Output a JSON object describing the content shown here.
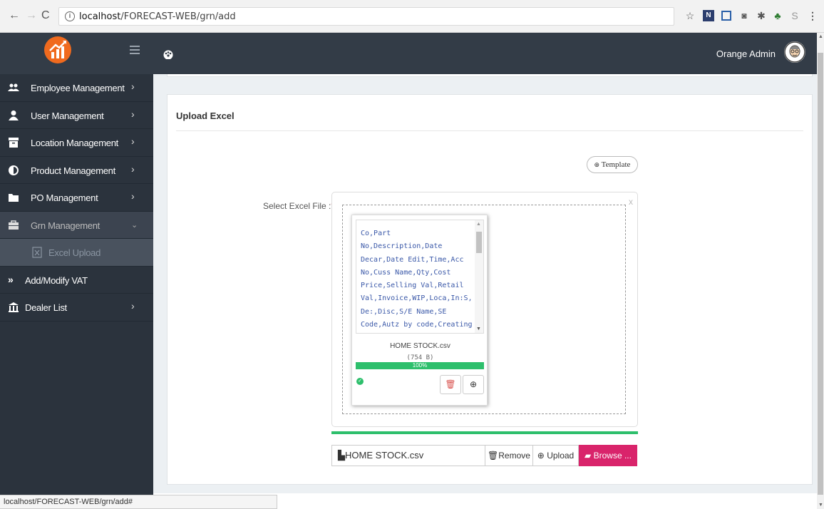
{
  "browser": {
    "url_host": "localhost",
    "url_path": "/FORECAST-WEB/grn/add",
    "info_icon": "info-circle-icon",
    "icons": [
      "star-icon",
      "extension-n-icon",
      "extension-doc-icon",
      "camera-icon",
      "extension-spark-icon",
      "puzzle-icon",
      "extension-s-icon",
      "more-vert-icon"
    ]
  },
  "header": {
    "user_name": "Orange Admin",
    "menu_icon": "hamburger-icon",
    "dashboard_icon": "palette-icon",
    "brand_color": "#f06a1e"
  },
  "sidebar": {
    "items": [
      {
        "label": "Employee Management",
        "icon": "users-icon"
      },
      {
        "label": "User Management",
        "icon": "user-icon"
      },
      {
        "label": "Location Management",
        "icon": "archive-icon"
      },
      {
        "label": "Product Management",
        "icon": "contrast-icon"
      },
      {
        "label": "PO Management",
        "icon": "folder-icon"
      },
      {
        "label": "Grn Management",
        "icon": "briefcase-icon"
      },
      {
        "label": "Excel Upload",
        "icon": "excel-file-icon"
      },
      {
        "label": "Add/Modify VAT",
        "icon": "double-chevron-icon"
      },
      {
        "label": "Dealer List",
        "icon": "bank-icon"
      }
    ]
  },
  "form": {
    "title": "Upload Excel",
    "template_button": "Template",
    "field_label": "Select Excel File :",
    "required_mark": "*",
    "close_mark": "x"
  },
  "file": {
    "preview": "Co,Part\nNo,Description,Date\nDecar,Date Edit,Time,Acc\nNo,Cuss Name,Qty,Cost\nPrice,Selling Val,Retail\nVal,Invoice,WIP,Loca,In:S,\nDe:,Disc,S/E Name,SE\nCode,Autz by code,Creating\nCo,Creating",
    "name": "HOME STOCK.csv",
    "size": "(754 B)",
    "progress_label": "100%",
    "progress": 1.0,
    "input_value": "HOME STOCK.csv"
  },
  "buttons": {
    "remove": "Remove",
    "upload": "Upload",
    "browse": "Browse ..."
  },
  "status_bar": "localhost/FORECAST-WEB/grn/add#"
}
